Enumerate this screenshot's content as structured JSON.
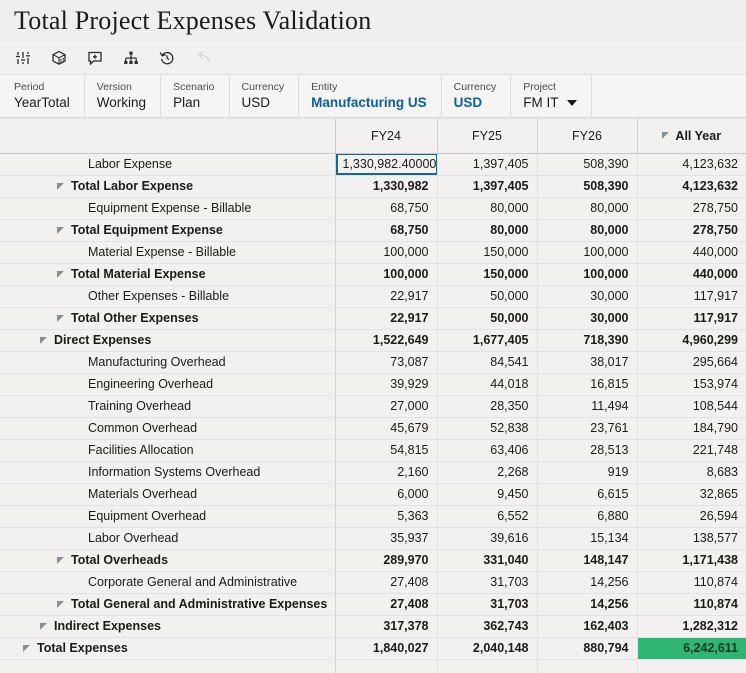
{
  "header": {
    "title": "Total Project Expenses Validation"
  },
  "toolbar": {
    "buttons": [
      {
        "name": "adjust-settings-icon",
        "label": "Adjust",
        "enabled": true
      },
      {
        "name": "cube-data-icon",
        "label": "Data Source",
        "enabled": true
      },
      {
        "name": "add-comment-icon",
        "label": "Add Comment",
        "enabled": true
      },
      {
        "name": "hierarchy-icon",
        "label": "Hierarchy",
        "enabled": true
      },
      {
        "name": "history-revert-icon",
        "label": "History",
        "enabled": true
      },
      {
        "name": "undo-icon",
        "label": "Undo",
        "enabled": false
      }
    ]
  },
  "pov": [
    {
      "label": "Period",
      "value": "YearTotal",
      "accent": false,
      "caret": false
    },
    {
      "label": "Version",
      "value": "Working",
      "accent": false,
      "caret": false
    },
    {
      "label": "Scenario",
      "value": "Plan",
      "accent": false,
      "caret": false
    },
    {
      "label": "Currency",
      "value": "USD",
      "accent": false,
      "caret": false
    },
    {
      "label": "Entity",
      "value": "Manufacturing US",
      "accent": true,
      "caret": false
    },
    {
      "label": "Currency",
      "value": "USD",
      "accent": true,
      "caret": false
    },
    {
      "label": "Project",
      "value": "FM IT",
      "accent": false,
      "caret": true
    }
  ],
  "grid": {
    "columns": [
      "",
      "FY24",
      "FY25",
      "FY26",
      "All Year"
    ],
    "all_year_collapse_icon": "collapse-triangle",
    "active_cell": {
      "row": "Labor Expense",
      "column": "FY24",
      "value": "1,330,982.40000"
    },
    "highlight_color": "#2FB673",
    "accent_color": "#0A5FA5",
    "active_border_color": "#15698A",
    "rows": [
      {
        "label": "Labor Expense",
        "indent": 3,
        "tri": false,
        "bold": false,
        "values": [
          "1,330,982.40000",
          "1,397,405",
          "508,390",
          "4,123,632"
        ],
        "active_col": 0
      },
      {
        "label": "Total Labor Expense",
        "indent": 2,
        "tri": true,
        "bold": true,
        "values": [
          "1,330,982",
          "1,397,405",
          "508,390",
          "4,123,632"
        ]
      },
      {
        "label": "Equipment Expense - Billable",
        "indent": 3,
        "tri": false,
        "bold": false,
        "values": [
          "68,750",
          "80,000",
          "80,000",
          "278,750"
        ]
      },
      {
        "label": "Total Equipment Expense",
        "indent": 2,
        "tri": true,
        "bold": true,
        "values": [
          "68,750",
          "80,000",
          "80,000",
          "278,750"
        ]
      },
      {
        "label": "Material Expense - Billable",
        "indent": 3,
        "tri": false,
        "bold": false,
        "values": [
          "100,000",
          "150,000",
          "100,000",
          "440,000"
        ]
      },
      {
        "label": "Total Material Expense",
        "indent": 2,
        "tri": true,
        "bold": true,
        "values": [
          "100,000",
          "150,000",
          "100,000",
          "440,000"
        ]
      },
      {
        "label": "Other Expenses - Billable",
        "indent": 3,
        "tri": false,
        "bold": false,
        "values": [
          "22,917",
          "50,000",
          "30,000",
          "117,917"
        ]
      },
      {
        "label": "Total Other Expenses",
        "indent": 2,
        "tri": true,
        "bold": true,
        "values": [
          "22,917",
          "50,000",
          "30,000",
          "117,917"
        ]
      },
      {
        "label": "Direct Expenses",
        "indent": 1,
        "tri": true,
        "bold": true,
        "values": [
          "1,522,649",
          "1,677,405",
          "718,390",
          "4,960,299"
        ]
      },
      {
        "label": "Manufacturing Overhead",
        "indent": 3,
        "tri": false,
        "bold": false,
        "values": [
          "73,087",
          "84,541",
          "38,017",
          "295,664"
        ]
      },
      {
        "label": "Engineering Overhead",
        "indent": 3,
        "tri": false,
        "bold": false,
        "values": [
          "39,929",
          "44,018",
          "16,815",
          "153,974"
        ]
      },
      {
        "label": "Training Overhead",
        "indent": 3,
        "tri": false,
        "bold": false,
        "values": [
          "27,000",
          "28,350",
          "11,494",
          "108,544"
        ]
      },
      {
        "label": "Common Overhead",
        "indent": 3,
        "tri": false,
        "bold": false,
        "values": [
          "45,679",
          "52,838",
          "23,761",
          "184,790"
        ]
      },
      {
        "label": "Facilities Allocation",
        "indent": 3,
        "tri": false,
        "bold": false,
        "values": [
          "54,815",
          "63,406",
          "28,513",
          "221,748"
        ]
      },
      {
        "label": "Information Systems Overhead",
        "indent": 3,
        "tri": false,
        "bold": false,
        "values": [
          "2,160",
          "2,268",
          "919",
          "8,683"
        ]
      },
      {
        "label": "Materials Overhead",
        "indent": 3,
        "tri": false,
        "bold": false,
        "values": [
          "6,000",
          "9,450",
          "6,615",
          "32,865"
        ]
      },
      {
        "label": "Equipment Overhead",
        "indent": 3,
        "tri": false,
        "bold": false,
        "values": [
          "5,363",
          "6,552",
          "6,880",
          "26,594"
        ]
      },
      {
        "label": "Labor Overhead",
        "indent": 3,
        "tri": false,
        "bold": false,
        "values": [
          "35,937",
          "39,616",
          "15,134",
          "138,577"
        ]
      },
      {
        "label": "Total Overheads",
        "indent": 2,
        "tri": true,
        "bold": true,
        "values": [
          "289,970",
          "331,040",
          "148,147",
          "1,171,438"
        ]
      },
      {
        "label": "Corporate General and Administrative",
        "indent": 3,
        "tri": false,
        "bold": false,
        "values": [
          "27,408",
          "31,703",
          "14,256",
          "110,874"
        ]
      },
      {
        "label": "Total General and Administrative Expenses",
        "indent": 2,
        "tri": true,
        "bold": true,
        "values": [
          "27,408",
          "31,703",
          "14,256",
          "110,874"
        ]
      },
      {
        "label": "Indirect Expenses",
        "indent": 1,
        "tri": true,
        "bold": true,
        "values": [
          "317,378",
          "362,743",
          "162,403",
          "1,282,312"
        ]
      },
      {
        "label": "Total Expenses",
        "indent": 0,
        "tri": true,
        "bold": true,
        "values": [
          "1,840,027",
          "2,040,148",
          "880,794",
          "6,242,611"
        ],
        "highlight_col": 3
      }
    ]
  }
}
